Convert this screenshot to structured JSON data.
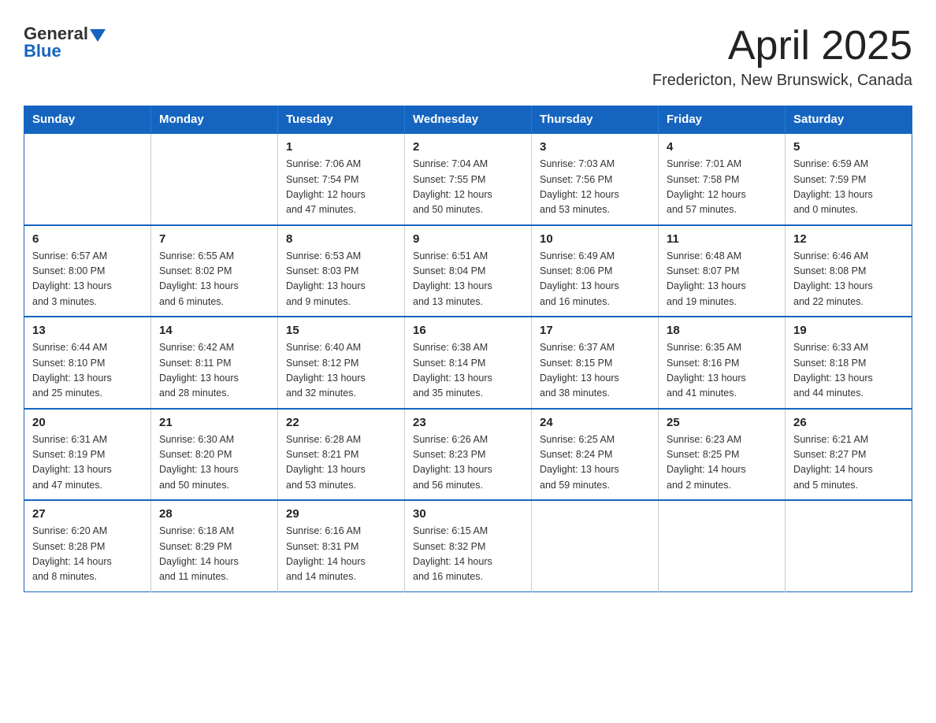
{
  "header": {
    "logo": {
      "general": "General",
      "blue": "Blue"
    },
    "title": "April 2025",
    "location": "Fredericton, New Brunswick, Canada"
  },
  "calendar": {
    "days_of_week": [
      "Sunday",
      "Monday",
      "Tuesday",
      "Wednesday",
      "Thursday",
      "Friday",
      "Saturday"
    ],
    "weeks": [
      [
        {
          "day": "",
          "info": ""
        },
        {
          "day": "",
          "info": ""
        },
        {
          "day": "1",
          "info": "Sunrise: 7:06 AM\nSunset: 7:54 PM\nDaylight: 12 hours\nand 47 minutes."
        },
        {
          "day": "2",
          "info": "Sunrise: 7:04 AM\nSunset: 7:55 PM\nDaylight: 12 hours\nand 50 minutes."
        },
        {
          "day": "3",
          "info": "Sunrise: 7:03 AM\nSunset: 7:56 PM\nDaylight: 12 hours\nand 53 minutes."
        },
        {
          "day": "4",
          "info": "Sunrise: 7:01 AM\nSunset: 7:58 PM\nDaylight: 12 hours\nand 57 minutes."
        },
        {
          "day": "5",
          "info": "Sunrise: 6:59 AM\nSunset: 7:59 PM\nDaylight: 13 hours\nand 0 minutes."
        }
      ],
      [
        {
          "day": "6",
          "info": "Sunrise: 6:57 AM\nSunset: 8:00 PM\nDaylight: 13 hours\nand 3 minutes."
        },
        {
          "day": "7",
          "info": "Sunrise: 6:55 AM\nSunset: 8:02 PM\nDaylight: 13 hours\nand 6 minutes."
        },
        {
          "day": "8",
          "info": "Sunrise: 6:53 AM\nSunset: 8:03 PM\nDaylight: 13 hours\nand 9 minutes."
        },
        {
          "day": "9",
          "info": "Sunrise: 6:51 AM\nSunset: 8:04 PM\nDaylight: 13 hours\nand 13 minutes."
        },
        {
          "day": "10",
          "info": "Sunrise: 6:49 AM\nSunset: 8:06 PM\nDaylight: 13 hours\nand 16 minutes."
        },
        {
          "day": "11",
          "info": "Sunrise: 6:48 AM\nSunset: 8:07 PM\nDaylight: 13 hours\nand 19 minutes."
        },
        {
          "day": "12",
          "info": "Sunrise: 6:46 AM\nSunset: 8:08 PM\nDaylight: 13 hours\nand 22 minutes."
        }
      ],
      [
        {
          "day": "13",
          "info": "Sunrise: 6:44 AM\nSunset: 8:10 PM\nDaylight: 13 hours\nand 25 minutes."
        },
        {
          "day": "14",
          "info": "Sunrise: 6:42 AM\nSunset: 8:11 PM\nDaylight: 13 hours\nand 28 minutes."
        },
        {
          "day": "15",
          "info": "Sunrise: 6:40 AM\nSunset: 8:12 PM\nDaylight: 13 hours\nand 32 minutes."
        },
        {
          "day": "16",
          "info": "Sunrise: 6:38 AM\nSunset: 8:14 PM\nDaylight: 13 hours\nand 35 minutes."
        },
        {
          "day": "17",
          "info": "Sunrise: 6:37 AM\nSunset: 8:15 PM\nDaylight: 13 hours\nand 38 minutes."
        },
        {
          "day": "18",
          "info": "Sunrise: 6:35 AM\nSunset: 8:16 PM\nDaylight: 13 hours\nand 41 minutes."
        },
        {
          "day": "19",
          "info": "Sunrise: 6:33 AM\nSunset: 8:18 PM\nDaylight: 13 hours\nand 44 minutes."
        }
      ],
      [
        {
          "day": "20",
          "info": "Sunrise: 6:31 AM\nSunset: 8:19 PM\nDaylight: 13 hours\nand 47 minutes."
        },
        {
          "day": "21",
          "info": "Sunrise: 6:30 AM\nSunset: 8:20 PM\nDaylight: 13 hours\nand 50 minutes."
        },
        {
          "day": "22",
          "info": "Sunrise: 6:28 AM\nSunset: 8:21 PM\nDaylight: 13 hours\nand 53 minutes."
        },
        {
          "day": "23",
          "info": "Sunrise: 6:26 AM\nSunset: 8:23 PM\nDaylight: 13 hours\nand 56 minutes."
        },
        {
          "day": "24",
          "info": "Sunrise: 6:25 AM\nSunset: 8:24 PM\nDaylight: 13 hours\nand 59 minutes."
        },
        {
          "day": "25",
          "info": "Sunrise: 6:23 AM\nSunset: 8:25 PM\nDaylight: 14 hours\nand 2 minutes."
        },
        {
          "day": "26",
          "info": "Sunrise: 6:21 AM\nSunset: 8:27 PM\nDaylight: 14 hours\nand 5 minutes."
        }
      ],
      [
        {
          "day": "27",
          "info": "Sunrise: 6:20 AM\nSunset: 8:28 PM\nDaylight: 14 hours\nand 8 minutes."
        },
        {
          "day": "28",
          "info": "Sunrise: 6:18 AM\nSunset: 8:29 PM\nDaylight: 14 hours\nand 11 minutes."
        },
        {
          "day": "29",
          "info": "Sunrise: 6:16 AM\nSunset: 8:31 PM\nDaylight: 14 hours\nand 14 minutes."
        },
        {
          "day": "30",
          "info": "Sunrise: 6:15 AM\nSunset: 8:32 PM\nDaylight: 14 hours\nand 16 minutes."
        },
        {
          "day": "",
          "info": ""
        },
        {
          "day": "",
          "info": ""
        },
        {
          "day": "",
          "info": ""
        }
      ]
    ]
  }
}
